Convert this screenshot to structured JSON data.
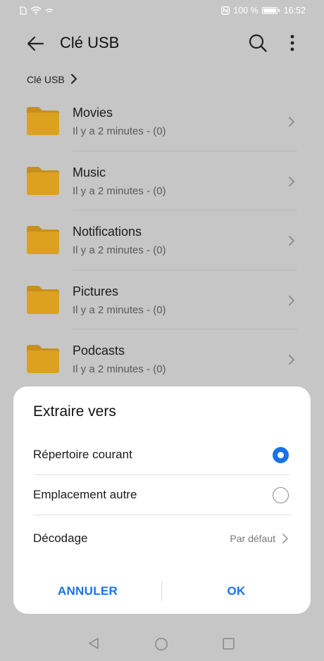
{
  "status_bar": {
    "battery_text": "100 %",
    "time": "16:52",
    "icons": [
      "sim-icon",
      "wifi-icon",
      "nfc-icon",
      "battery-icon"
    ]
  },
  "app_bar": {
    "title": "Clé USB",
    "icons": [
      "back-arrow-icon",
      "search-icon",
      "more-vert-icon"
    ]
  },
  "breadcrumb": {
    "label": "Clé USB"
  },
  "files": [
    {
      "name": "Movies",
      "meta": "Il y a 2 minutes - (0)"
    },
    {
      "name": "Music",
      "meta": "Il y a 2 minutes - (0)"
    },
    {
      "name": "Notifications",
      "meta": "Il y a 2 minutes - (0)"
    },
    {
      "name": "Pictures",
      "meta": "Il y a 2 minutes - (0)"
    },
    {
      "name": "Podcasts",
      "meta": "Il y a 2 minutes - (0)"
    }
  ],
  "dialog": {
    "title": "Extraire vers",
    "options": [
      {
        "label": "Répertoire courant",
        "selected": true
      },
      {
        "label": "Emplacement autre",
        "selected": false
      }
    ],
    "decoding": {
      "label": "Décodage",
      "value": "Par défaut"
    },
    "cancel_label": "ANNULER",
    "ok_label": "OK"
  },
  "colors": {
    "accent": "#1a73e8",
    "folder": "#dca11f",
    "scrim_background": "#c6c6c6"
  }
}
